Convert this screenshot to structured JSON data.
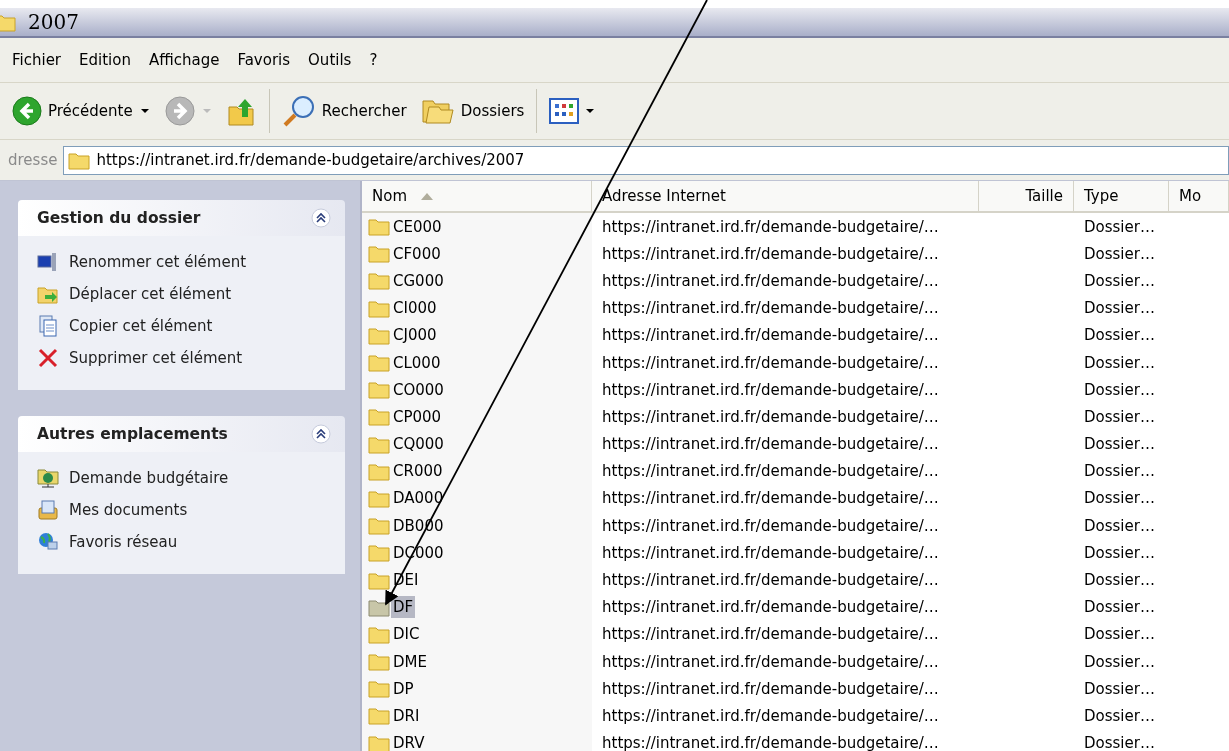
{
  "window": {
    "title": "2007"
  },
  "menu": [
    "Fichier",
    "Edition",
    "Affichage",
    "Favoris",
    "Outils",
    "?"
  ],
  "toolbar": {
    "back": "Précédente",
    "search": "Rechercher",
    "folders": "Dossiers"
  },
  "address": {
    "label": "dresse",
    "value": "https://intranet.ird.fr/demande-budgetaire/archives/2007"
  },
  "panels": [
    {
      "title": "Gestion du dossier",
      "expanded": true,
      "items": [
        {
          "label": "Renommer cet élément",
          "kind": "rename"
        },
        {
          "label": "Déplacer cet élément",
          "kind": "move"
        },
        {
          "label": "Copier cet élément",
          "kind": "copy"
        },
        {
          "label": "Supprimer cet élément",
          "kind": "delete"
        }
      ]
    },
    {
      "title": "Autres emplacements",
      "expanded": true,
      "items": [
        {
          "label": "Demande budgétaire",
          "kind": "webfolder"
        },
        {
          "label": "Mes documents",
          "kind": "documents"
        },
        {
          "label": "Favoris réseau",
          "kind": "network"
        }
      ]
    }
  ],
  "columns": [
    "Nom",
    "Adresse Internet",
    "Taille",
    "Type",
    "Mo"
  ],
  "rows": [
    {
      "name": "CE000",
      "address": "https://intranet.ird.fr/demande-budgetaire/…",
      "type": "Dossier…",
      "selected": false
    },
    {
      "name": "CF000",
      "address": "https://intranet.ird.fr/demande-budgetaire/…",
      "type": "Dossier…",
      "selected": false
    },
    {
      "name": "CG000",
      "address": "https://intranet.ird.fr/demande-budgetaire/…",
      "type": "Dossier…",
      "selected": false
    },
    {
      "name": "CI000",
      "address": "https://intranet.ird.fr/demande-budgetaire/…",
      "type": "Dossier…",
      "selected": false
    },
    {
      "name": "CJ000",
      "address": "https://intranet.ird.fr/demande-budgetaire/…",
      "type": "Dossier…",
      "selected": false
    },
    {
      "name": "CL000",
      "address": "https://intranet.ird.fr/demande-budgetaire/…",
      "type": "Dossier…",
      "selected": false
    },
    {
      "name": "CO000",
      "address": "https://intranet.ird.fr/demande-budgetaire/…",
      "type": "Dossier…",
      "selected": false
    },
    {
      "name": "CP000",
      "address": "https://intranet.ird.fr/demande-budgetaire/…",
      "type": "Dossier…",
      "selected": false
    },
    {
      "name": "CQ000",
      "address": "https://intranet.ird.fr/demande-budgetaire/…",
      "type": "Dossier…",
      "selected": false
    },
    {
      "name": "CR000",
      "address": "https://intranet.ird.fr/demande-budgetaire/…",
      "type": "Dossier…",
      "selected": false
    },
    {
      "name": "DA000",
      "address": "https://intranet.ird.fr/demande-budgetaire/…",
      "type": "Dossier…",
      "selected": false
    },
    {
      "name": "DB000",
      "address": "https://intranet.ird.fr/demande-budgetaire/…",
      "type": "Dossier…",
      "selected": false
    },
    {
      "name": "DC000",
      "address": "https://intranet.ird.fr/demande-budgetaire/…",
      "type": "Dossier…",
      "selected": false
    },
    {
      "name": "DEI",
      "address": "https://intranet.ird.fr/demande-budgetaire/…",
      "type": "Dossier…",
      "selected": false
    },
    {
      "name": "DF",
      "address": "https://intranet.ird.fr/demande-budgetaire/…",
      "type": "Dossier…",
      "selected": true
    },
    {
      "name": "DIC",
      "address": "https://intranet.ird.fr/demande-budgetaire/…",
      "type": "Dossier…",
      "selected": false
    },
    {
      "name": "DME",
      "address": "https://intranet.ird.fr/demande-budgetaire/…",
      "type": "Dossier…",
      "selected": false
    },
    {
      "name": "DP",
      "address": "https://intranet.ird.fr/demande-budgetaire/…",
      "type": "Dossier…",
      "selected": false
    },
    {
      "name": "DRI",
      "address": "https://intranet.ird.fr/demande-budgetaire/…",
      "type": "Dossier…",
      "selected": false
    },
    {
      "name": "DRV",
      "address": "https://intranet.ird.fr/demande-budgetaire/…",
      "type": "Dossier…",
      "selected": false
    }
  ]
}
